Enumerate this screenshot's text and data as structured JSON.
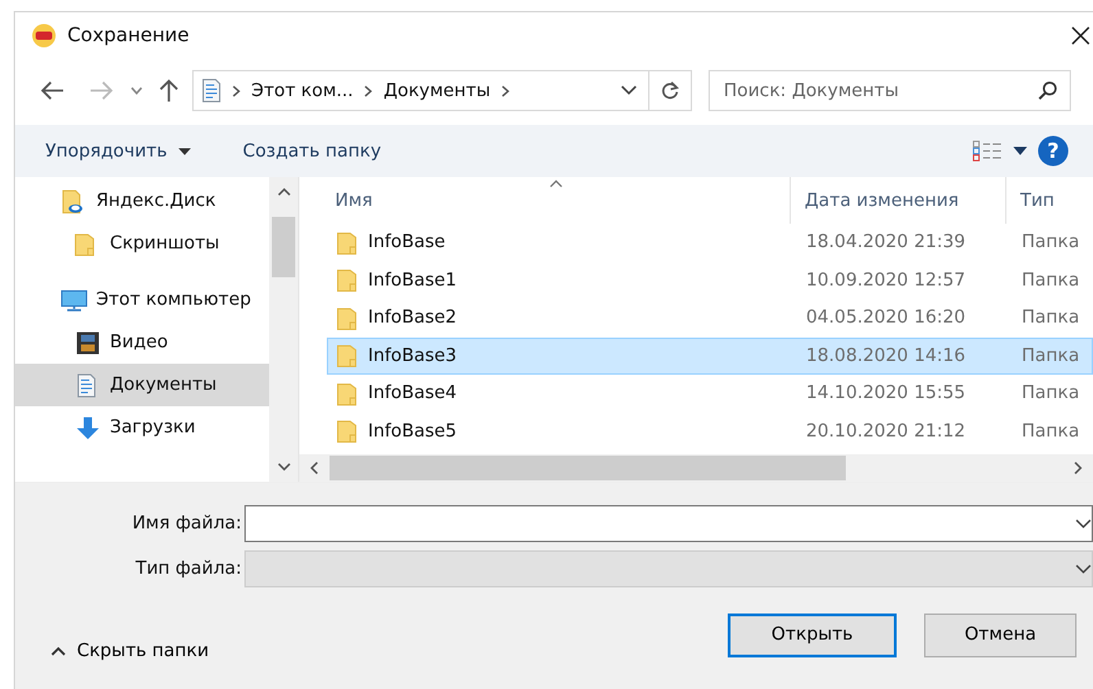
{
  "window": {
    "title": "Сохранение"
  },
  "address": {
    "crumbs": [
      "Этот ком...",
      "Документы"
    ]
  },
  "search": {
    "placeholder": "Поиск: Документы"
  },
  "toolbar": {
    "buttons": [
      "Упорядочить",
      "Создать папку"
    ],
    "help": "?"
  },
  "sidebar": {
    "items": [
      {
        "label": "Яндекс.Диск",
        "kind": "cloud",
        "selected": false,
        "children": [
          {
            "label": "Скриншоты",
            "kind": "folder",
            "selected": false
          }
        ]
      },
      {
        "label": "Этот компьютер",
        "kind": "computer",
        "selected": false,
        "children": [
          {
            "label": "Видео",
            "kind": "video",
            "selected": false
          },
          {
            "label": "Документы",
            "kind": "documents",
            "selected": true
          },
          {
            "label": "Загрузки",
            "kind": "downloads",
            "selected": false
          }
        ]
      }
    ]
  },
  "table": {
    "columns": [
      "Имя",
      "Дата изменения",
      "Тип"
    ],
    "rows": [
      {
        "name": "InfoBase",
        "date": "18.04.2020 21:39",
        "type": "Папка",
        "selected": false
      },
      {
        "name": "InfoBase1",
        "date": "10.09.2020 12:57",
        "type": "Папка",
        "selected": false
      },
      {
        "name": "InfoBase2",
        "date": "04.05.2020 16:20",
        "type": "Папка",
        "selected": false
      },
      {
        "name": "InfoBase3",
        "date": "18.08.2020 14:16",
        "type": "Папка",
        "selected": true
      },
      {
        "name": "InfoBase4",
        "date": "14.10.2020 15:55",
        "type": "Папка",
        "selected": false
      },
      {
        "name": "InfoBase5",
        "date": "20.10.2020 21:12",
        "type": "Папка",
        "selected": false
      }
    ]
  },
  "form": {
    "file_name": {
      "label": "Имя файла:"
    },
    "file_type": {
      "label": "Тип файла:",
      "disabled": true
    }
  },
  "footer": {
    "toggle": "Скрыть папки",
    "buttons": [
      {
        "label": "Открыть",
        "kind": "primary"
      },
      {
        "label": "Отмена",
        "kind": "normal"
      }
    ]
  }
}
